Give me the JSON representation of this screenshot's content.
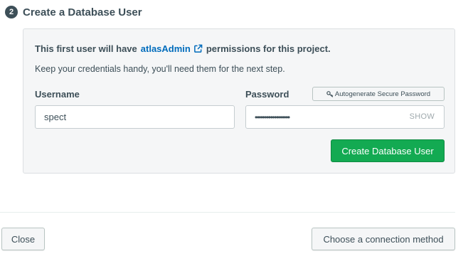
{
  "step": {
    "number": "2",
    "title": "Create a Database User"
  },
  "panel": {
    "info_prefix": "This first user will have",
    "info_link": "atlasAdmin",
    "info_suffix": "permissions for this project.",
    "subtext": "Keep your credentials handy, you'll need them for the next step.",
    "username_label": "Username",
    "username_value": "spect",
    "password_label": "Password",
    "password_masked": "••••••••••••••••••",
    "password_toggle": "SHOW",
    "autogenerate_label": "Autogenerate Secure Password",
    "create_button": "Create Database User"
  },
  "footer": {
    "close_button": "Close",
    "connect_button": "Choose a connection method"
  },
  "icons": {
    "external_link": "external-link-icon",
    "key": "key-icon"
  },
  "colors": {
    "primary_green": "#13aa52",
    "link_blue": "#006cbc",
    "text_dark": "#3d4f58",
    "panel_bg": "#f5f6f7"
  }
}
